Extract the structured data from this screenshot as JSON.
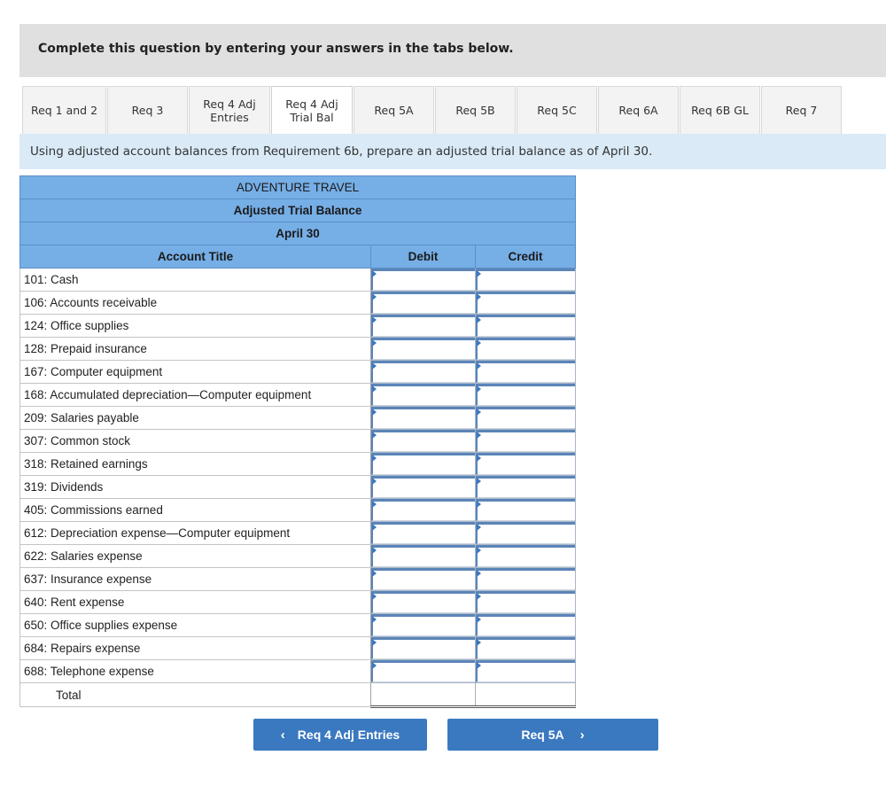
{
  "instructions": {
    "text": "Complete this question by entering your answers in the tabs below."
  },
  "tabs": [
    {
      "label": "Req 1 and 2",
      "active": false
    },
    {
      "label": "Req 3",
      "active": false
    },
    {
      "label": "Req 4 Adj\nEntries",
      "active": false
    },
    {
      "label": "Req 4 Adj\nTrial Bal",
      "active": true
    },
    {
      "label": "Req 5A",
      "active": false
    },
    {
      "label": "Req 5B",
      "active": false
    },
    {
      "label": "Req 5C",
      "active": false
    },
    {
      "label": "Req 6A",
      "active": false
    },
    {
      "label": "Req 6B GL",
      "active": false
    },
    {
      "label": "Req 7",
      "active": false
    }
  ],
  "prompt": {
    "text": "Using adjusted account balances from Requirement 6b, prepare an adjusted trial balance as of April 30."
  },
  "trial_balance": {
    "company": "ADVENTURE TRAVEL",
    "title": "Adjusted Trial Balance",
    "date": "April 30",
    "columns": {
      "account": "Account Title",
      "debit": "Debit",
      "credit": "Credit"
    },
    "rows": [
      {
        "account": "101: Cash",
        "debit": "",
        "credit": ""
      },
      {
        "account": "106: Accounts receivable",
        "debit": "",
        "credit": ""
      },
      {
        "account": "124: Office supplies",
        "debit": "",
        "credit": ""
      },
      {
        "account": "128: Prepaid insurance",
        "debit": "",
        "credit": ""
      },
      {
        "account": "167: Computer equipment",
        "debit": "",
        "credit": ""
      },
      {
        "account": "168: Accumulated depreciation—Computer equipment",
        "debit": "",
        "credit": ""
      },
      {
        "account": "209: Salaries payable",
        "debit": "",
        "credit": ""
      },
      {
        "account": "307: Common stock",
        "debit": "",
        "credit": ""
      },
      {
        "account": "318: Retained earnings",
        "debit": "",
        "credit": ""
      },
      {
        "account": "319: Dividends",
        "debit": "",
        "credit": ""
      },
      {
        "account": "405: Commissions earned",
        "debit": "",
        "credit": ""
      },
      {
        "account": "612: Depreciation expense—Computer equipment",
        "debit": "",
        "credit": ""
      },
      {
        "account": "622: Salaries expense",
        "debit": "",
        "credit": ""
      },
      {
        "account": "637: Insurance expense",
        "debit": "",
        "credit": ""
      },
      {
        "account": "640: Rent expense",
        "debit": "",
        "credit": ""
      },
      {
        "account": "650: Office supplies expense",
        "debit": "",
        "credit": ""
      },
      {
        "account": "684: Repairs expense",
        "debit": "",
        "credit": ""
      },
      {
        "account": "688: Telephone expense",
        "debit": "",
        "credit": ""
      }
    ],
    "total": {
      "label": "Total",
      "debit": "",
      "credit": ""
    }
  },
  "navigation": {
    "prev": {
      "label": "Req 4 Adj Entries",
      "icon": "chevron-left-icon",
      "glyph": "‹"
    },
    "next": {
      "label": "Req 5A",
      "icon": "chevron-right-icon",
      "glyph": "›"
    }
  },
  "colors": {
    "header_blue": "#76aee6",
    "button_blue": "#3a79c0",
    "prompt_bg": "#daeaf7",
    "instructions_bg": "#e0e0e0"
  }
}
